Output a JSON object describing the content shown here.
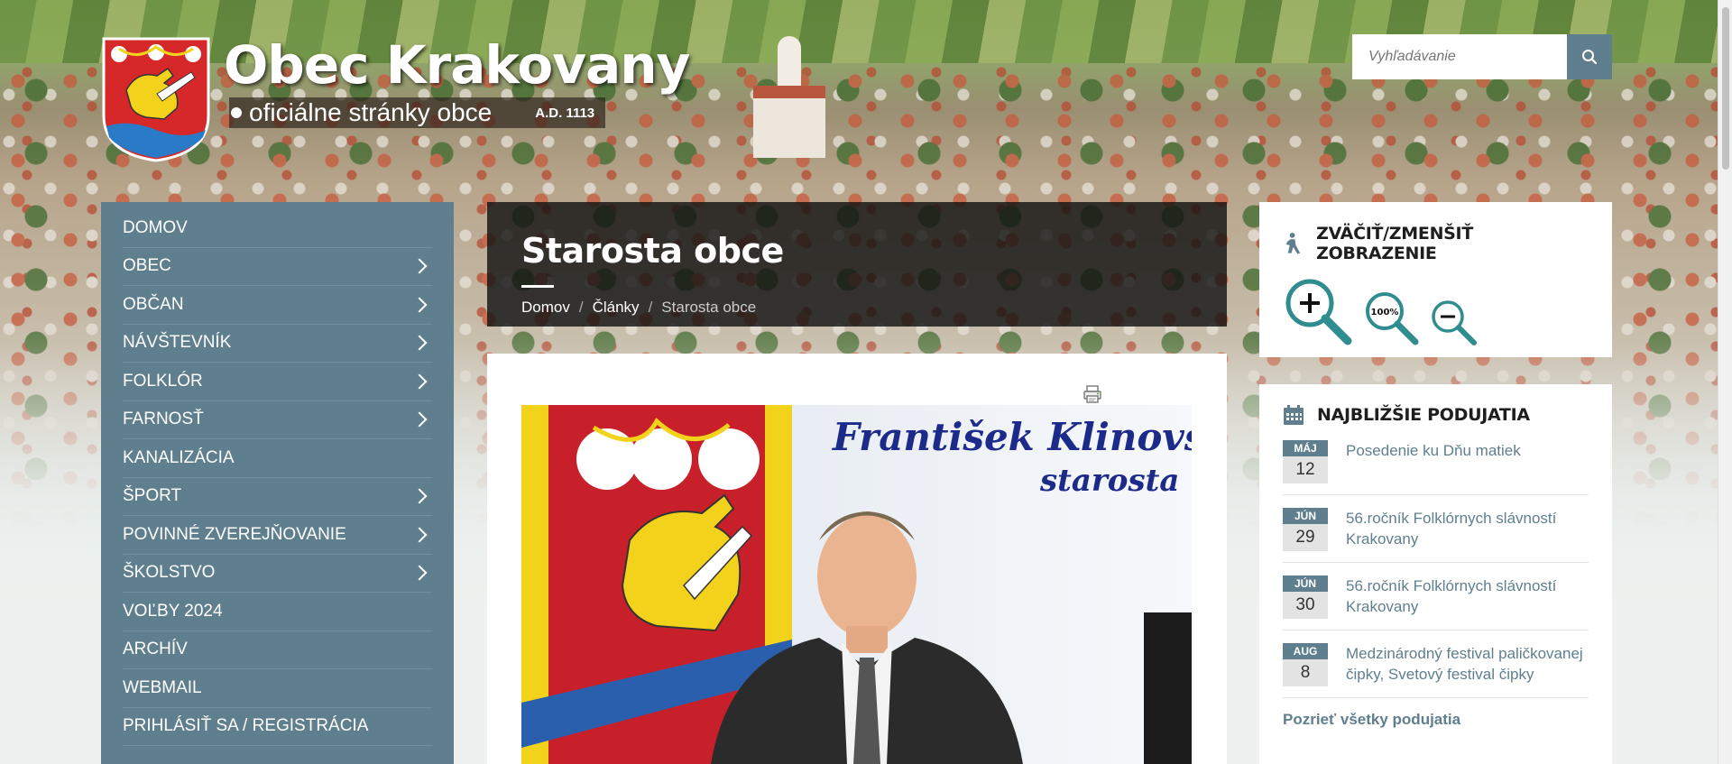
{
  "header": {
    "title": "Obec Krakovany",
    "subtitle": "oficiálne stránky obce",
    "founded": "A.D. 1113"
  },
  "search": {
    "placeholder": "Vyhľadávanie"
  },
  "nav": {
    "items": [
      {
        "label": "DOMOV",
        "has_submenu": false
      },
      {
        "label": "OBEC",
        "has_submenu": true
      },
      {
        "label": "OBČAN",
        "has_submenu": true
      },
      {
        "label": "NÁVŠTEVNÍK",
        "has_submenu": true
      },
      {
        "label": "FOLKLÓR",
        "has_submenu": true
      },
      {
        "label": "FARNOSŤ",
        "has_submenu": true
      },
      {
        "label": "KANALIZÁCIA",
        "has_submenu": false
      },
      {
        "label": "ŠPORT",
        "has_submenu": true
      },
      {
        "label": "POVINNÉ ZVEREJŇOVANIE",
        "has_submenu": true
      },
      {
        "label": "ŠKOLSTVO",
        "has_submenu": true
      },
      {
        "label": "VOĽBY 2024",
        "has_submenu": false
      },
      {
        "label": "ARCHÍV",
        "has_submenu": false
      },
      {
        "label": "WEBMAIL",
        "has_submenu": false
      },
      {
        "label": "PRIHLÁSIŤ SA / REGISTRÁCIA",
        "has_submenu": false
      }
    ]
  },
  "page": {
    "title": "Starosta obce",
    "breadcrumb": {
      "home": "Domov",
      "separator": "/",
      "section": "Články",
      "current": "Starosta obce"
    }
  },
  "article": {
    "image_name_line": "František Klinovský",
    "image_role_line": "starosta"
  },
  "zoom_widget": {
    "title": "ZVÄČIŤ/ZMENŠIŤ ZOBRAZENIE",
    "reset_label": "100%"
  },
  "events_widget": {
    "title": "NAJBLIŽŠIE PODUJATIA",
    "events": [
      {
        "month": "MÁJ",
        "day": "12",
        "title": "Posedenie ku Dňu matiek"
      },
      {
        "month": "JÚN",
        "day": "29",
        "title": "56.ročník Folklórnych slávností Krakovany"
      },
      {
        "month": "JÚN",
        "day": "30",
        "title": "56.ročník Folklórnych slávností Krakovany"
      },
      {
        "month": "AUG",
        "day": "8",
        "title": "Medzinárodný festival paličkovanej čipky, Svetový festival čipky"
      }
    ],
    "see_all": "Pozrieť všetky podujatia"
  },
  "colors": {
    "accent": "#5f7f8e",
    "zoom_icon": "#2f8c8f",
    "header_band": "#141414",
    "crest_red": "#d62828",
    "crest_yellow": "#f2d21b",
    "crest_blue": "#2a7bc7"
  },
  "icons": {
    "search": "search-icon",
    "accessibility": "accessibility-icon",
    "calendar": "calendar-icon",
    "print": "print-icon",
    "submenu": "chevron-right-icon"
  }
}
